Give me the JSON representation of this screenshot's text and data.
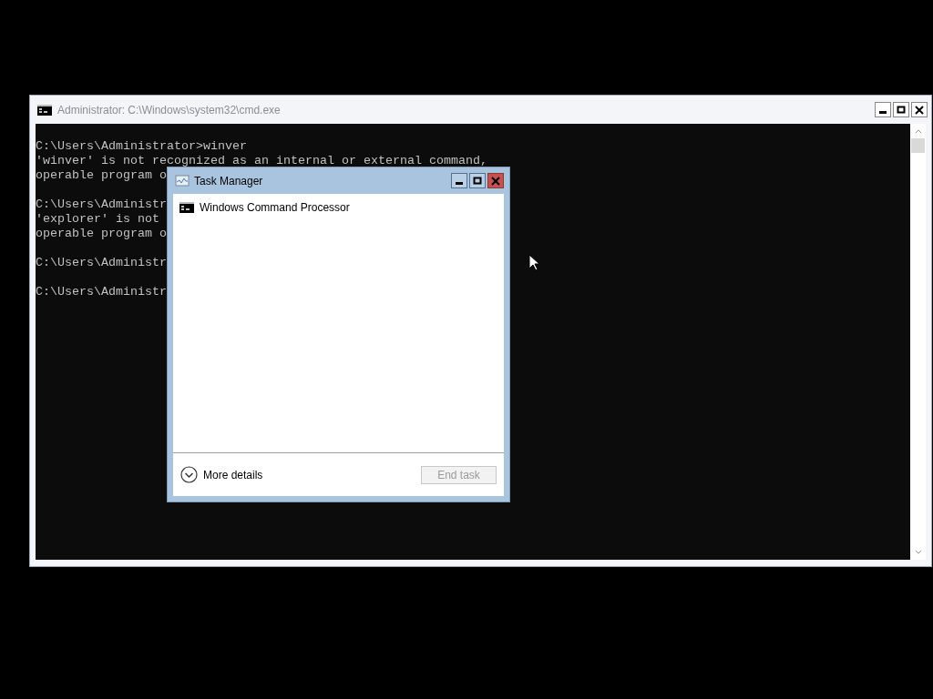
{
  "console_window": {
    "title": "Administrator: C:\\Windows\\system32\\cmd.exe",
    "blocks": [
      [
        "C:\\Users\\Administrator>winver",
        "'winver' is not recognized as an internal or external command,",
        "operable program o"
      ],
      [
        "C:\\Users\\Administr",
        "'explorer' is not",
        "operable program o"
      ],
      [
        "C:\\Users\\Administr"
      ],
      [
        "C:\\Users\\Administr"
      ]
    ]
  },
  "task_manager": {
    "title": "Task Manager",
    "apps": [
      {
        "name": "Windows Command Processor"
      }
    ],
    "more_details": "More details",
    "end_task": {
      "label": "End task",
      "disabled": true
    }
  }
}
